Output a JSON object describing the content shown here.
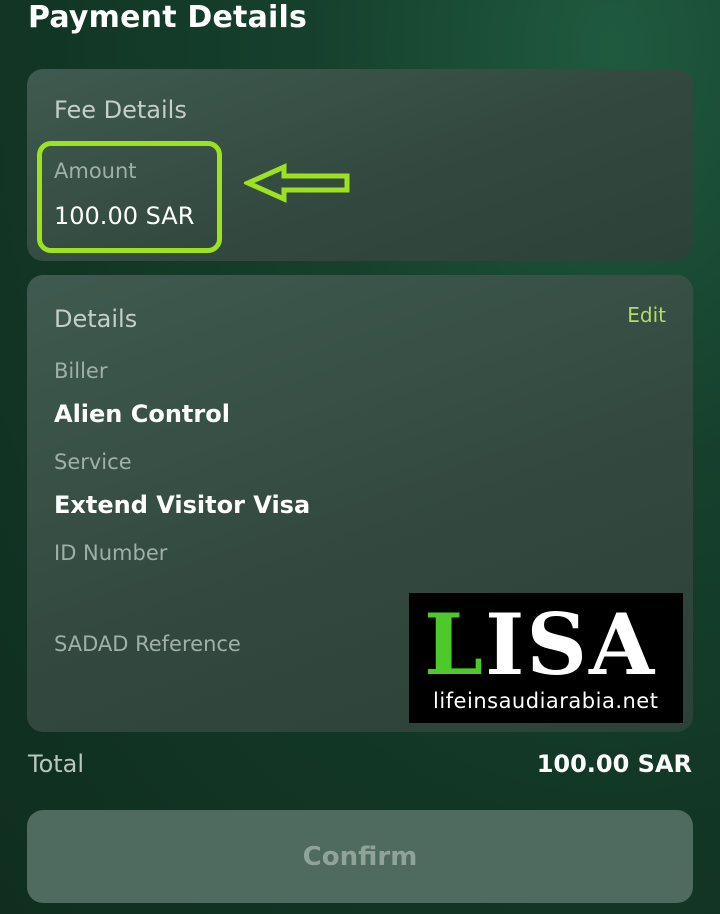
{
  "header": {
    "title": "Payment Details"
  },
  "fee_details": {
    "title": "Fee Details",
    "amount_label": "Amount",
    "amount_value": "100.00 SAR"
  },
  "details": {
    "title": "Details",
    "edit_label": "Edit",
    "fields": [
      {
        "label": "Biller",
        "value": "Alien Control"
      },
      {
        "label": "Service",
        "value": "Extend Visitor Visa"
      },
      {
        "label": "ID Number",
        "value": ""
      },
      {
        "label": "SADAD Reference",
        "value": ""
      }
    ]
  },
  "watermark": {
    "logo_first": "L",
    "logo_rest": "ISA",
    "url": "lifeinsaudiarabia.net"
  },
  "summary": {
    "total_label": "Total",
    "total_value": "100.00 SAR"
  },
  "actions": {
    "confirm_label": "Confirm"
  },
  "colors": {
    "highlight": "#9ce21e",
    "edit_link": "#b7d96c",
    "logo_green": "#4ec92b"
  }
}
